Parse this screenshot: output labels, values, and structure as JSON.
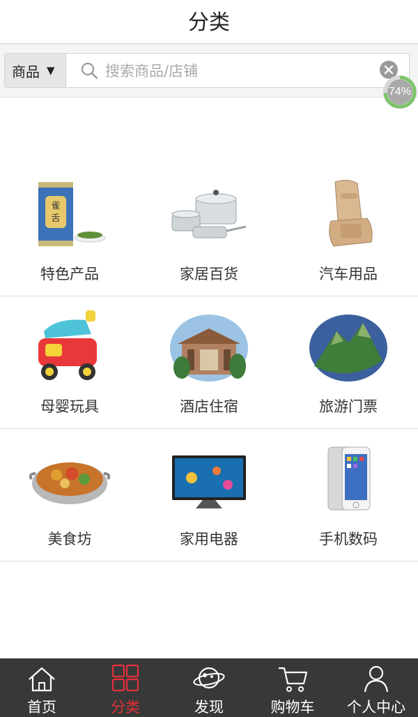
{
  "header": {
    "title": "分类"
  },
  "search": {
    "scope": "商品",
    "placeholder": "搜索商品/店铺",
    "progress_badge": "74%",
    "progress_value": 0.74
  },
  "categories": [
    {
      "label": "特色产品",
      "icon": "tea-can-icon"
    },
    {
      "label": "家居百货",
      "icon": "cookware-icon"
    },
    {
      "label": "汽车用品",
      "icon": "car-seat-icon"
    },
    {
      "label": "母婴玩具",
      "icon": "toy-car-icon"
    },
    {
      "label": "酒店住宿",
      "icon": "hotel-icon"
    },
    {
      "label": "旅游门票",
      "icon": "mountain-icon"
    },
    {
      "label": "美食坊",
      "icon": "food-pot-icon"
    },
    {
      "label": "家用电器",
      "icon": "tv-icon"
    },
    {
      "label": "手机数码",
      "icon": "smartphone-icon"
    }
  ],
  "tabbar": {
    "active": 1,
    "tabs": [
      {
        "label": "首页",
        "icon": "home-icon"
      },
      {
        "label": "分类",
        "icon": "grid-icon"
      },
      {
        "label": "发现",
        "icon": "planet-icon"
      },
      {
        "label": "购物车",
        "icon": "cart-icon"
      },
      {
        "label": "个人中心",
        "icon": "user-icon"
      }
    ]
  },
  "colors": {
    "accent": "#e5303b",
    "tabbar_bg": "#383838",
    "badge": "#6fbf5a"
  }
}
